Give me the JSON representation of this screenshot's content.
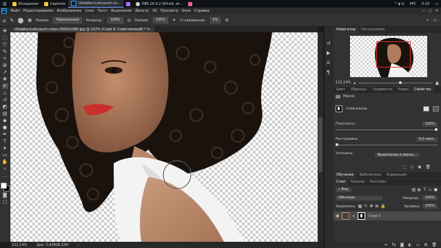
{
  "taskbar": {
    "apps": [
      {
        "label": "Исходники",
        "color": "#f5c542"
      },
      {
        "label": "Captures",
        "color": "#f5c542"
      },
      {
        "label": "Ukladka-kudryavyh-vo...",
        "color": "#31a8ff"
      },
      {
        "label": "",
        "color": "#a66bff"
      },
      {
        "label": "OBS 26.0.2 (64-bit, wi...",
        "color": "#d0d0d0"
      },
      {
        "label": "",
        "color": "#f06292"
      }
    ],
    "language": "РУС",
    "time": "0:10"
  },
  "menu": [
    "Файл",
    "Редактирование",
    "Изображение",
    "Слои",
    "Текст",
    "Выделение",
    "Фильтр",
    "3D",
    "Просмотр",
    "Окно",
    "Справка"
  ],
  "options": {
    "mode_label": "Режим:",
    "mode_value": "Нормальный",
    "opacity_label": "Непрозр.:",
    "opacity_value": "100%",
    "flow_label": "Нажим:",
    "flow_value": "100%",
    "smoothing_label": "Сглаживание:",
    "smoothing_value": "0%"
  },
  "document": {
    "tab_title": "Ukladka-kudryavyh-volos-1920x1080.jpg @ 122% (Слой 0, Слой-маска/8) *"
  },
  "status": {
    "zoom": "122,14%",
    "doc_info": "Док: 5,93M/8,32M"
  },
  "navigator": {
    "tabs": [
      "Навигатор",
      "Гистограмма"
    ],
    "zoom": "122,14%"
  },
  "properties": {
    "tabs": [
      "Цвет",
      "Образцы",
      "Градиенты",
      "Узоры",
      "Свойства"
    ],
    "section": "Маски",
    "mask_label": "Слой-маска",
    "density_label": "Плотность:",
    "density_value": "100%",
    "feather_label": "Растушевка:",
    "feather_value": "0,0 пикс.",
    "refine_label": "Уточнить:",
    "select_mask_button": "Выделение и маска..."
  },
  "layers": {
    "top_tabs": [
      "Обучение",
      "Библиотеки",
      "Коррекция"
    ],
    "tabs": [
      "Слои",
      "Каналы",
      "Контуры"
    ],
    "filter_value": "Вид",
    "blend_mode": "Обычные",
    "opacity_label": "Непрозр.:",
    "opacity_value": "100%",
    "lock_label": "Закрепить:",
    "fill_label": "Заливка:",
    "fill_value": "100%",
    "items": [
      {
        "name": "Слой 0"
      }
    ]
  },
  "colors": {
    "accent": "#31a8ff",
    "ui_bg": "#323232"
  }
}
